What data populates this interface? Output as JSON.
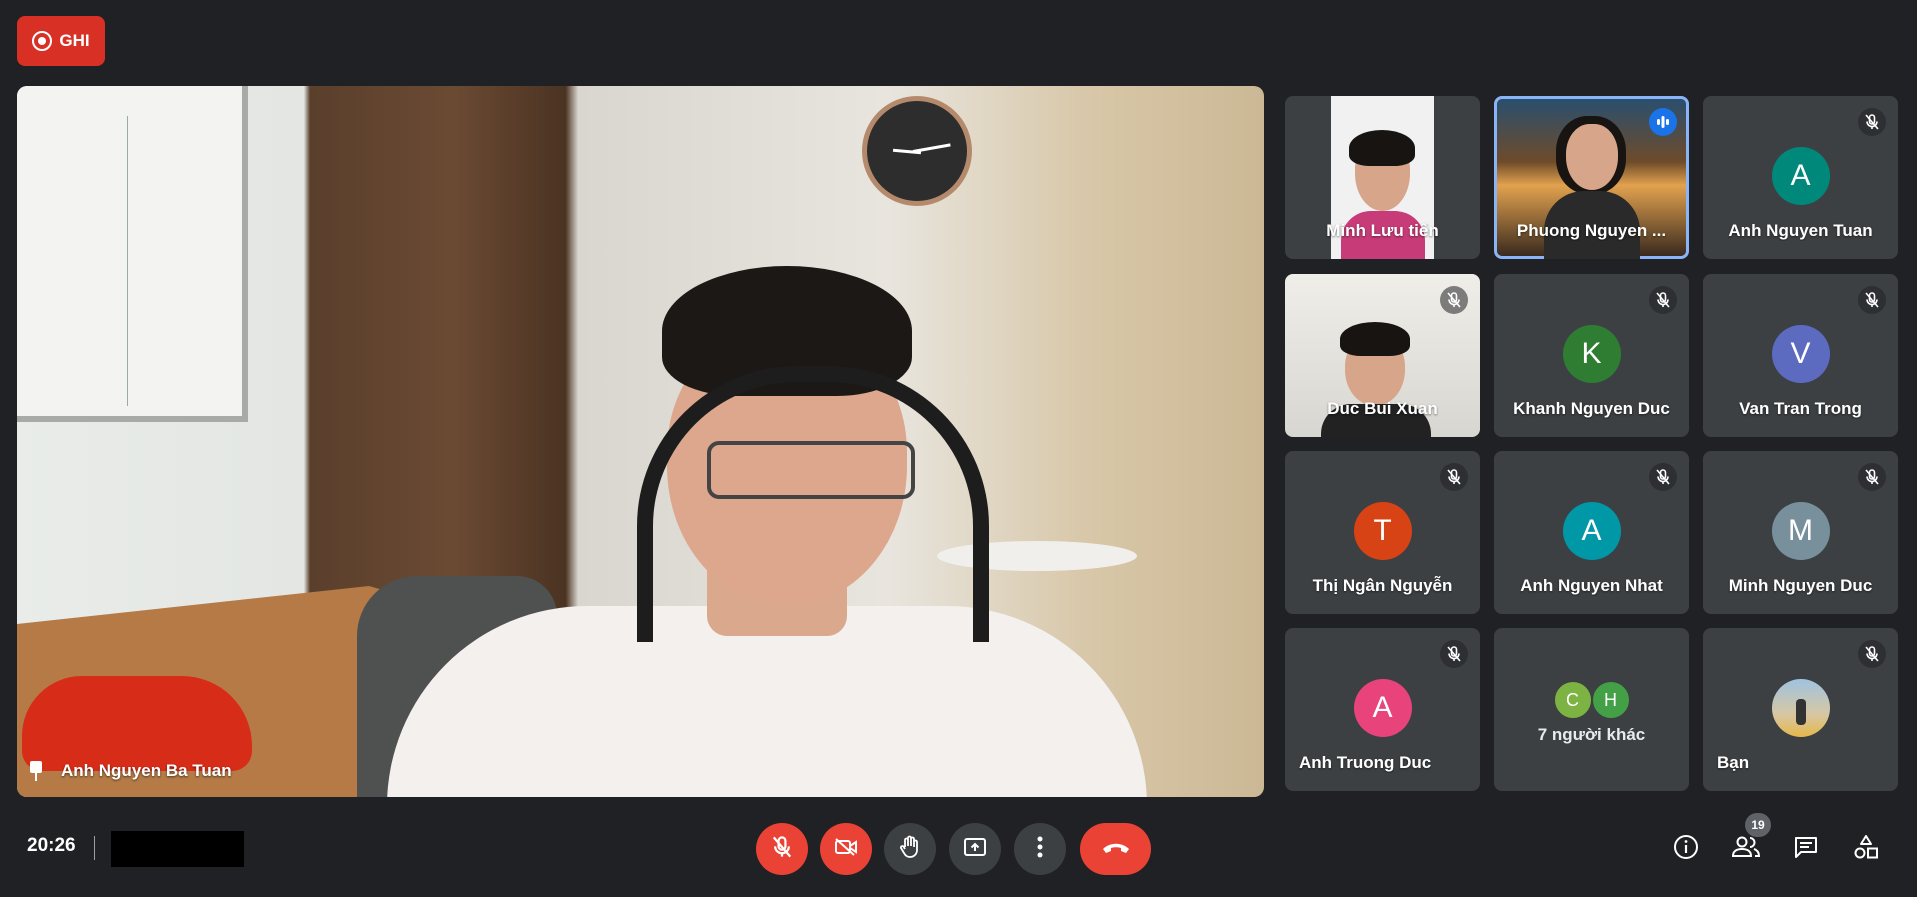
{
  "recording": {
    "label": "GHI",
    "color": "#d93025"
  },
  "main_speaker": {
    "name": "Anh Nguyen Ba Tuan",
    "pinned": true
  },
  "tiles": [
    {
      "name": "Minh Lưu tiến",
      "video": true,
      "muted": false
    },
    {
      "name": "Phuong Nguyen ...",
      "video": true,
      "speaking": true
    },
    {
      "name": "Anh Nguyen Tuan",
      "initial": "A",
      "color": "#00897b",
      "muted": true
    },
    {
      "name": "Duc Bui Xuan",
      "video": true,
      "muted": true
    },
    {
      "name": "Khanh Nguyen Duc",
      "initial": "K",
      "color": "#2e7d32",
      "muted": true
    },
    {
      "name": "Van Tran Trong",
      "initial": "V",
      "color": "#5c6bc0",
      "muted": true
    },
    {
      "name": "Thị Ngân Nguyễn",
      "initial": "T",
      "color": "#d84315",
      "muted": true
    },
    {
      "name": "Anh Nguyen Nhat",
      "initial": "A",
      "color": "#0097a7",
      "muted": true
    },
    {
      "name": "Minh Nguyen Duc",
      "initial": "M",
      "color": "#78909c",
      "muted": true
    },
    {
      "name": "Anh Truong Duc",
      "initial": "A",
      "color": "#e8437b",
      "muted": true
    },
    {
      "others_label": "7 người khác",
      "avatars": [
        {
          "initial": "C",
          "color": "#7cb342"
        },
        {
          "initial": "H",
          "color": "#43a047"
        }
      ]
    },
    {
      "name": "Bạn",
      "muted": true
    }
  ],
  "bottom_bar": {
    "time": "20:26",
    "participant_count": "19",
    "controls": [
      "mic-off",
      "camera-off",
      "raise-hand",
      "present-screen",
      "more-options",
      "leave-call"
    ],
    "right_icons": [
      "info",
      "people",
      "chat",
      "activities"
    ]
  }
}
